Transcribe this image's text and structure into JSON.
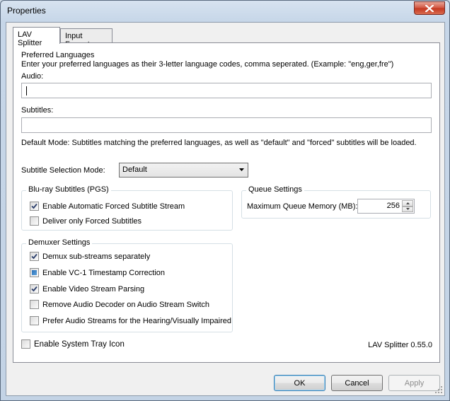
{
  "window": {
    "title": "Properties"
  },
  "tabs": [
    {
      "label": "LAV Splitter",
      "active": true
    },
    {
      "label": "Input Formats",
      "active": false
    }
  ],
  "languages": {
    "heading": "Preferred Languages",
    "instructions": "Enter your preferred languages as their 3-letter language codes, comma seperated. (Example: \"eng,ger,fre\")",
    "audio_label": "Audio:",
    "audio_value": "",
    "subtitles_label": "Subtitles:",
    "subtitles_value": "",
    "mode_description": "Default Mode: Subtitles matching the preferred languages, as well as \"default\" and \"forced\" subtitles will be loaded."
  },
  "subtitle_mode": {
    "label": "Subtitle Selection Mode:",
    "selected": "Default"
  },
  "bluray": {
    "title": "Blu-ray Subtitles (PGS)",
    "options": [
      {
        "label": "Enable Automatic Forced Subtitle Stream",
        "state": "checked"
      },
      {
        "label": "Deliver only Forced Subtitles",
        "state": "unchecked"
      }
    ]
  },
  "queue": {
    "title": "Queue Settings",
    "memory_label": "Maximum Queue Memory (MB):",
    "memory_value": "256"
  },
  "demuxer": {
    "title": "Demuxer Settings",
    "options": [
      {
        "label": "Demux sub-streams separately",
        "state": "checked"
      },
      {
        "label": "Enable VC-1 Timestamp Correction",
        "state": "indeterminate"
      },
      {
        "label": "Enable Video Stream Parsing",
        "state": "checked"
      },
      {
        "label": "Remove Audio Decoder on Audio Stream Switch",
        "state": "unchecked"
      },
      {
        "label": "Prefer Audio Streams for the Hearing/Visually Impaired",
        "state": "unchecked"
      }
    ]
  },
  "tray": {
    "label": "Enable System Tray Icon",
    "state": "unchecked"
  },
  "version": "LAV Splitter 0.55.0",
  "buttons": {
    "ok": "OK",
    "cancel": "Cancel",
    "apply": "Apply"
  },
  "icons": {
    "close": "close-icon",
    "dropdown": "chevron-down-icon",
    "check": "check-icon"
  }
}
